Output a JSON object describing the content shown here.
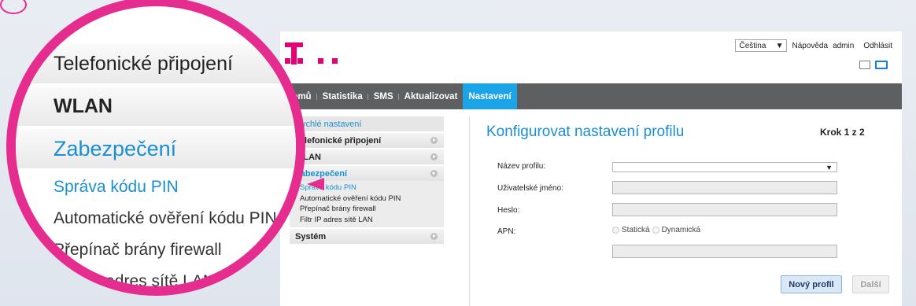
{
  "colors": {
    "accent": "#e20074",
    "nav_active": "#1ba4e8",
    "link": "#1b8fd1",
    "lens_ring": "#e52d8f"
  },
  "topbar": {
    "language": "Čeština",
    "help": "Nápověda",
    "user": "admin",
    "logout": "Odhlásit"
  },
  "nav": [
    {
      "label": "Domů",
      "active": false
    },
    {
      "label": "Statistika",
      "active": false
    },
    {
      "label": "SMS",
      "active": false
    },
    {
      "label": "Aktualizovat",
      "active": false
    },
    {
      "label": "Nastavení",
      "active": true
    }
  ],
  "sidebar": {
    "quick": "Rychlé nastavení",
    "items": [
      {
        "label": "Telefonické připojení"
      },
      {
        "label": "WLAN"
      },
      {
        "label": "Zabezpečení"
      },
      {
        "label": "Systém"
      }
    ],
    "submenu": [
      "Správa kódu PIN",
      "Automatické ověření kódu PIN",
      "Přepínač brány firewall",
      "Filtr IP adres sítě LAN"
    ]
  },
  "main": {
    "title": "Konfigurovat nastavení profilu",
    "step": "Krok 1 z 2",
    "fields": {
      "profile_name": "Název profilu:",
      "username": "Uživatelské jméno:",
      "password": "Heslo:",
      "apn": "APN:"
    },
    "apn_options": [
      "Statická",
      "Dynamická"
    ],
    "buttons": {
      "new_profile": "Nový profil",
      "next": "Další"
    }
  },
  "lens": {
    "rows": [
      "Telefonické připojení",
      "WLAN",
      "Zabezpečení"
    ],
    "sub": [
      "Správa kódu PIN",
      "Automatické ověření kódu PIN",
      "Přepínač brány firewall",
      "Filtr IP adres sítě LAN"
    ]
  }
}
